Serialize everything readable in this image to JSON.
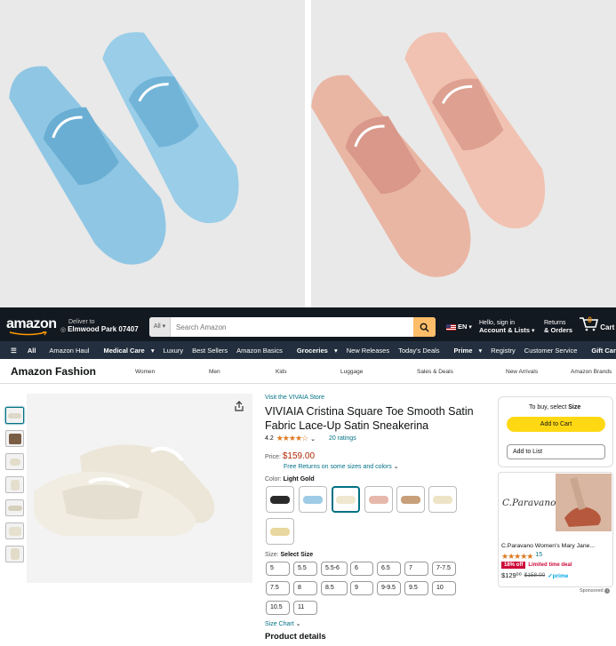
{
  "header": {
    "logo": "amazon",
    "deliver_line1": "Deliver to",
    "deliver_line2": "Elmwood Park 07407",
    "search_category": "All",
    "search_placeholder": "Search Amazon",
    "language": "EN",
    "account_line1": "Hello, sign in",
    "account_line2": "Account & Lists",
    "returns_line1": "Returns",
    "returns_line2": "& Orders",
    "cart_count": "0",
    "cart_label": "Cart"
  },
  "subnav": [
    "All",
    "Amazon Haul",
    "Medical Care",
    "Luxury",
    "Best Sellers",
    "Amazon Basics",
    "Groceries",
    "New Releases",
    "Today's Deals",
    "Prime",
    "Registry",
    "Customer Service",
    "Gift Cards"
  ],
  "store": {
    "title": "Amazon Fashion",
    "links": [
      "Women",
      "Men",
      "Kids",
      "Luggage",
      "Sales & Deals",
      "New Arrivals",
      "Amazon Brands"
    ]
  },
  "product": {
    "store_link": "Visit the VIVAIA Store",
    "title": "VIVIAIA Cristina Square Toe Smooth Satin Fabric Lace-Up Satin Sneakerina",
    "rating": "4.2",
    "stars": "★★★★☆",
    "ratings_count": "20 ratings",
    "price_label": "Price:",
    "price": "$159.00",
    "returns": "Free Returns on some sizes and colors",
    "color_label": "Color:",
    "color_value": "Light Gold",
    "size_label": "Size:",
    "size_value": "Select Size",
    "sizes": [
      "5",
      "5.5",
      "5.5-6",
      "6",
      "6.5",
      "7",
      "7-7.5",
      "7.5",
      "8",
      "8.5",
      "9",
      "9-9.5",
      "9.5",
      "10",
      "10.5",
      "11"
    ],
    "size_chart": "Size Chart",
    "details_heading": "Product details"
  },
  "buybox": {
    "hint_prefix": "To buy, select",
    "hint_bold": "Size",
    "add_to_cart": "Add to Cart",
    "add_to_list": "Add to List"
  },
  "ad": {
    "brand": "C.Paravano",
    "title": "C.Paravano Women's Mary Jane...",
    "stars": "★★★★★",
    "reviews": "15",
    "deal_badge": "18% off",
    "deal_text": "Limited time deal",
    "price": "$129⁰⁰",
    "old_price": "$158.00",
    "prime": "✓prime",
    "sponsored": "Sponsored"
  },
  "colors": {
    "nav_bg": "#131921",
    "subnav_bg": "#232f3e",
    "search_btn": "#febd69",
    "cart_btn": "#ffd814",
    "link": "#007185",
    "price": "#b12704",
    "swatches": [
      "#2a2a2a",
      "#9ecbe6",
      "#efe7cf",
      "#e6b8ac",
      "#c7a07a",
      "#ede3c6",
      "#e8d79e"
    ]
  }
}
